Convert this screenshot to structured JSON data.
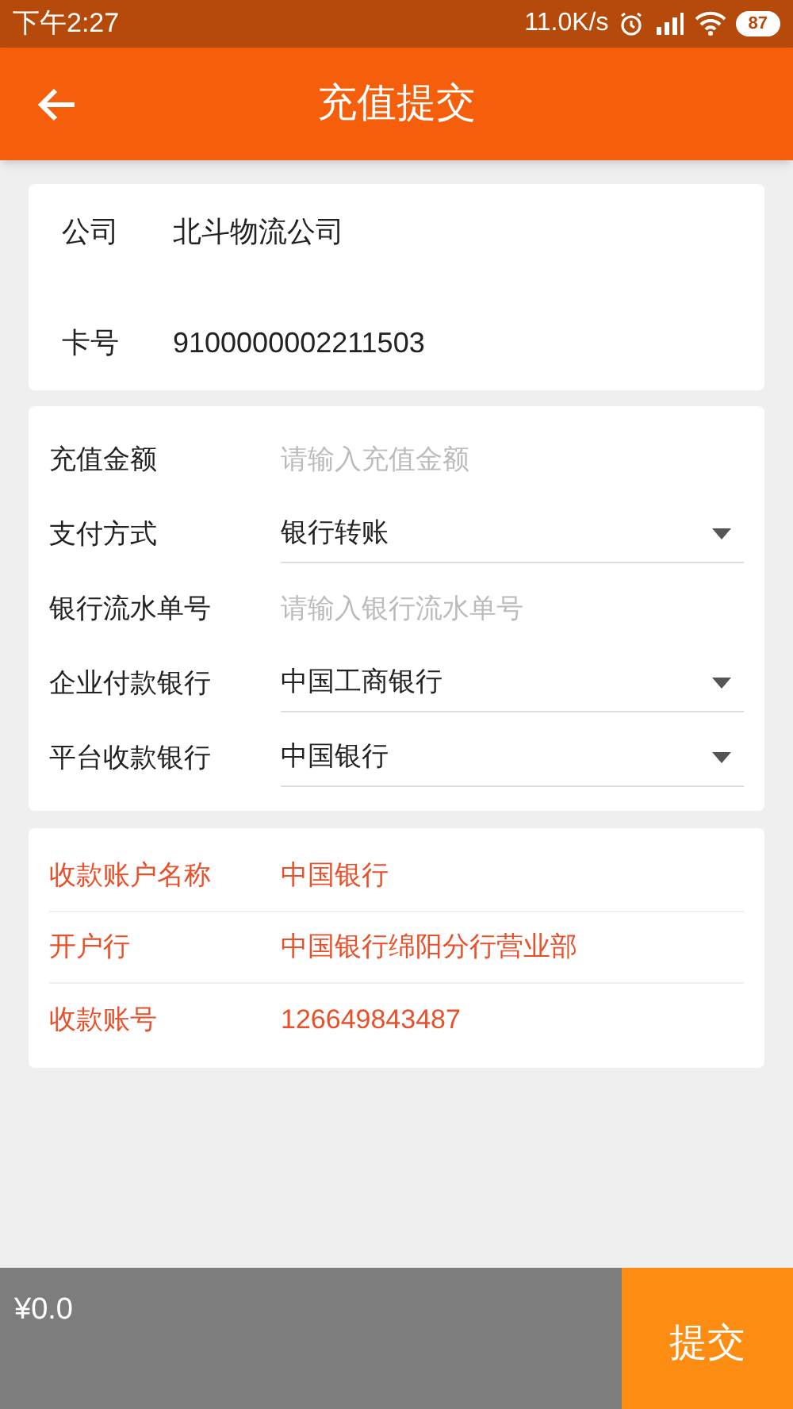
{
  "status_bar": {
    "time": "下午2:27",
    "net_speed": "11.0K/s",
    "battery": "87"
  },
  "header": {
    "title": "充值提交"
  },
  "company_card": [
    {
      "label": "公司",
      "value": "北斗物流公司"
    },
    {
      "label": "卡号",
      "value": "9100000002211503"
    }
  ],
  "form": [
    {
      "kind": "input",
      "label": "充值金额",
      "placeholder": "请输入充值金额"
    },
    {
      "kind": "select",
      "label": "支付方式",
      "value": "银行转账"
    },
    {
      "kind": "input",
      "label": "银行流水单号",
      "placeholder": "请输入银行流水单号"
    },
    {
      "kind": "select",
      "label": "企业付款银行",
      "value": "中国工商银行"
    },
    {
      "kind": "select",
      "label": "平台收款银行",
      "value": "中国银行"
    }
  ],
  "account_info": [
    {
      "label": "收款账户名称",
      "value": "中国银行"
    },
    {
      "label": "开户行",
      "value": "中国银行绵阳分行营业部"
    },
    {
      "label": "收款账号",
      "value": "126649843487"
    }
  ],
  "footer": {
    "total": "¥0.0",
    "submit": "提交"
  }
}
